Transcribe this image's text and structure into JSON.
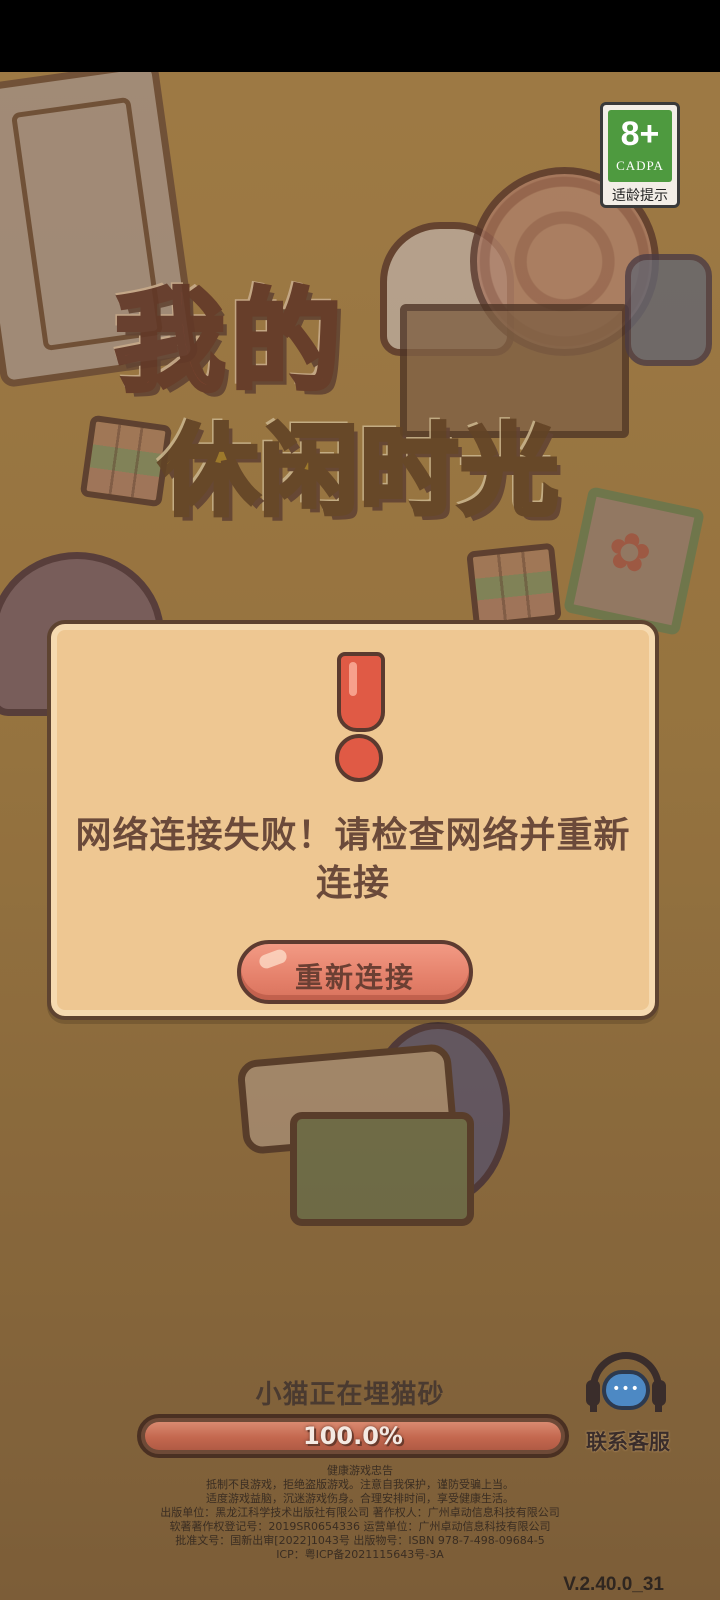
{
  "age_rating": {
    "rating": "8+",
    "org": "CADPA",
    "hint": "适龄提示"
  },
  "title": {
    "line1": "我的",
    "line2": "休闲时光"
  },
  "dialog": {
    "message": "网络连接失败！请检查网络并重新连接",
    "retry_label": "重新连接",
    "icon": "exclamation-icon",
    "accent_color": "#e05a45"
  },
  "loading": {
    "status_text": "小猫正在埋猫砂",
    "progress_text": "100.0%",
    "progress_value": 1.0
  },
  "support": {
    "icon": "customer-service-headset-icon",
    "label": "联系客服"
  },
  "legal": {
    "lines": [
      "健康游戏忠告",
      "抵制不良游戏，拒绝盗版游戏。注意自我保护，谨防受骗上当。",
      "适度游戏益脑，沉迷游戏伤身。合理安排时间，享受健康生活。",
      "出版单位：黑龙江科学技术出版社有限公司   著作权人：广州卓动信息科技有限公司",
      "软著著作权登记号：2019SR0654336   运营单位：广州卓动信息科技有限公司",
      "批准文号：国新出审[2022]1043号   出版物号：ISBN 978-7-498-09684-5",
      "ICP：粤ICP备2021115643号-3A"
    ]
  },
  "version": "V.2.40.0_31"
}
